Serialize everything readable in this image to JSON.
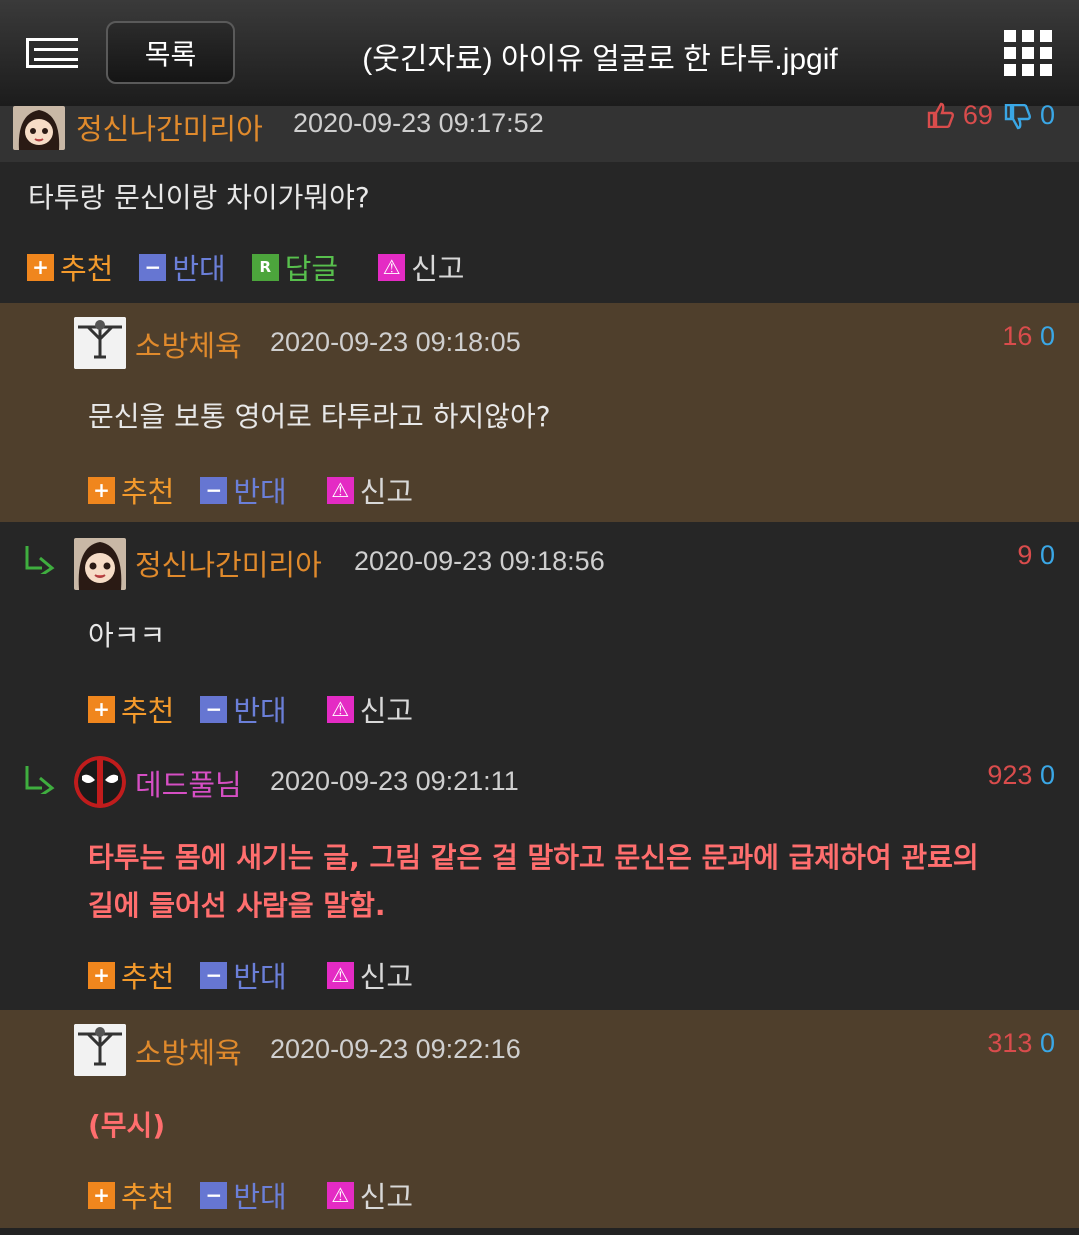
{
  "header": {
    "list_label": "목록",
    "title": "(웃긴자료) 아이유 얼굴로 한 타투.jpgif"
  },
  "comments": [
    {
      "nick": "정신나간미리아",
      "nick_color": "#e08a2c",
      "date": "2020-09-23 09:17:52",
      "up": "69",
      "down": "0",
      "text": "타투랑 문신이랑 차이가뭐야?",
      "actions": {
        "up": "추천",
        "down": "반대",
        "reply": "답글",
        "report": "신고"
      }
    },
    {
      "nick": "소방체육",
      "nick_color": "#e08a2c",
      "date": "2020-09-23 09:18:05",
      "up": "16",
      "down": "0",
      "text": "문신을 보통 영어로 타투라고 하지않아?",
      "actions": {
        "up": "추천",
        "down": "반대",
        "report": "신고"
      }
    },
    {
      "nick": "정신나간미리아",
      "nick_color": "#e08a2c",
      "date": "2020-09-23 09:18:56",
      "up": "9",
      "down": "0",
      "text": "아ㅋㅋ",
      "actions": {
        "up": "추천",
        "down": "반대",
        "report": "신고"
      }
    },
    {
      "nick": "데드풀님",
      "nick_color": "#d64fc4",
      "date": "2020-09-23 09:21:11",
      "up": "923",
      "down": "0",
      "text_line1": "타투는 몸에 새기는 글, 그림 같은 걸 말하고 문신은 문과에 급제하여 관료의",
      "text_line2": "길에 들어선 사람을 말함.",
      "actions": {
        "up": "추천",
        "down": "반대",
        "report": "신고"
      }
    },
    {
      "nick": "소방체육",
      "nick_color": "#e08a2c",
      "date": "2020-09-23 09:22:16",
      "up": "313",
      "down": "0",
      "text": "(무시)",
      "actions": {
        "up": "추천",
        "down": "반대",
        "report": "신고"
      }
    }
  ]
}
